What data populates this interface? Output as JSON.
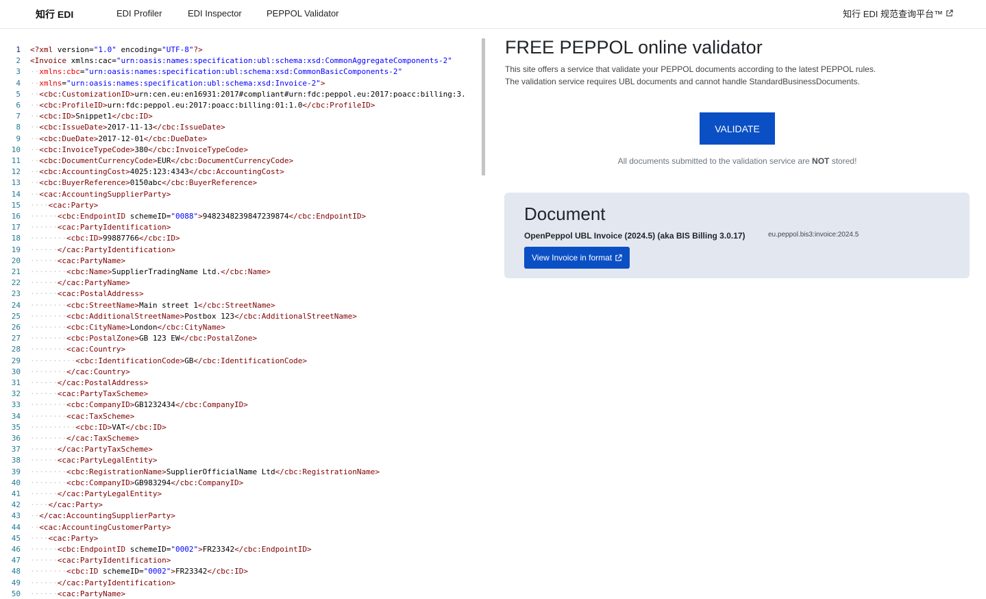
{
  "nav": {
    "brand": "知行 EDI",
    "links": [
      "EDI Profiler",
      "EDI Inspector",
      "PEPPOL Validator"
    ],
    "right_link": "知行 EDI 规范查询平台™"
  },
  "editor": {
    "lines": [
      "<?xml version=\"1.0\" encoding=\"UTF-8\"?>",
      "<Invoice xmlns:cac=\"urn:oasis:names:specification:ubl:schema:xsd:CommonAggregateComponents-2\"",
      "  xmlns:cbc=\"urn:oasis:names:specification:ubl:schema:xsd:CommonBasicComponents-2\"",
      "  xmlns=\"urn:oasis:names:specification:ubl:schema:xsd:Invoice-2\">",
      "  <cbc:CustomizationID>urn:cen.eu:en16931:2017#compliant#urn:fdc:peppol.eu:2017:poacc:billing:3.",
      "  <cbc:ProfileID>urn:fdc:peppol.eu:2017:poacc:billing:01:1.0</cbc:ProfileID>",
      "  <cbc:ID>Snippet1</cbc:ID>",
      "  <cbc:IssueDate>2017-11-13</cbc:IssueDate>",
      "  <cbc:DueDate>2017-12-01</cbc:DueDate>",
      "  <cbc:InvoiceTypeCode>380</cbc:InvoiceTypeCode>",
      "  <cbc:DocumentCurrencyCode>EUR</cbc:DocumentCurrencyCode>",
      "  <cbc:AccountingCost>4025:123:4343</cbc:AccountingCost>",
      "  <cbc:BuyerReference>0150abc</cbc:BuyerReference>",
      "  <cac:AccountingSupplierParty>",
      "    <cac:Party>",
      "      <cbc:EndpointID schemeID=\"0088\">9482348239847239874</cbc:EndpointID>",
      "      <cac:PartyIdentification>",
      "        <cbc:ID>99887766</cbc:ID>",
      "      </cac:PartyIdentification>",
      "      <cac:PartyName>",
      "        <cbc:Name>SupplierTradingName Ltd.</cbc:Name>",
      "      </cac:PartyName>",
      "      <cac:PostalAddress>",
      "        <cbc:StreetName>Main street 1</cbc:StreetName>",
      "        <cbc:AdditionalStreetName>Postbox 123</cbc:AdditionalStreetName>",
      "        <cbc:CityName>London</cbc:CityName>",
      "        <cbc:PostalZone>GB 123 EW</cbc:PostalZone>",
      "        <cac:Country>",
      "          <cbc:IdentificationCode>GB</cbc:IdentificationCode>",
      "        </cac:Country>",
      "      </cac:PostalAddress>",
      "      <cac:PartyTaxScheme>",
      "        <cbc:CompanyID>GB1232434</cbc:CompanyID>",
      "        <cac:TaxScheme>",
      "          <cbc:ID>VAT</cbc:ID>",
      "        </cac:TaxScheme>",
      "      </cac:PartyTaxScheme>",
      "      <cac:PartyLegalEntity>",
      "        <cbc:RegistrationName>SupplierOfficialName Ltd</cbc:RegistrationName>",
      "        <cbc:CompanyID>GB983294</cbc:CompanyID>",
      "      </cac:PartyLegalEntity>",
      "    </cac:Party>",
      "  </cac:AccountingSupplierParty>",
      "  <cac:AccountingCustomerParty>",
      "    <cac:Party>",
      "      <cbc:EndpointID schemeID=\"0002\">FR23342</cbc:EndpointID>",
      "      <cac:PartyIdentification>",
      "        <cbc:ID schemeID=\"0002\">FR23342</cbc:ID>",
      "      </cac:PartyIdentification>",
      "      <cac:PartyName>"
    ]
  },
  "main": {
    "title": "FREE PEPPOL online validator",
    "desc1": "This site offers a service that validate your PEPPOL documents according to the latest PEPPOL rules.",
    "desc2": "The validation service requires UBL documents and cannot handle StandardBusinessDocuments.",
    "validate_label": "VALIDATE",
    "notice_pre": "All documents submitted to the validation service are ",
    "notice_bold": "NOT",
    "notice_post": " stored!"
  },
  "document": {
    "heading": "Document",
    "type": "OpenPeppol UBL Invoice (2024.5) (aka BIS Billing 3.0.17)",
    "id": "eu.peppol.bis3:invoice:2024.5",
    "view_label": "View Invoice in format"
  }
}
